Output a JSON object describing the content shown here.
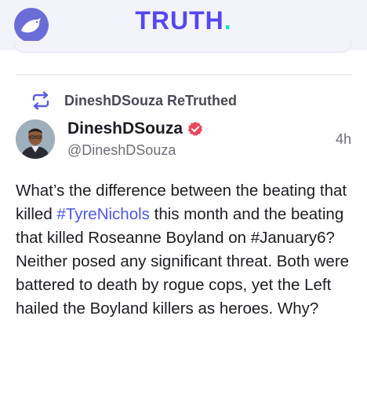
{
  "header": {
    "brand_name": "TRUTH",
    "brand_dot": ".",
    "logo_icon": "eagle-icon",
    "brand_color": "#5448ee",
    "accent_color": "#17e2c0"
  },
  "retruth": {
    "icon": "retruth-icon",
    "label": "DineshDSouza ReTruthed"
  },
  "post": {
    "author_name": "DineshDSouza",
    "verified_icon": "verified-badge-icon",
    "verified_color": "#e8475f",
    "handle": "@DineshDSouza",
    "time": "4h",
    "body_parts": {
      "p1": "What’s the difference between the beating that killed ",
      "hashtag": "#TyreNichols",
      "p2": " this month and the beating that killed Roseanne Boyland on #January6? Neither posed any significant threat. Both were battered to death by rogue cops, yet the Left hailed the Boyland killers as heroes. Why?"
    },
    "hashtag_color": "#4f56e6"
  }
}
